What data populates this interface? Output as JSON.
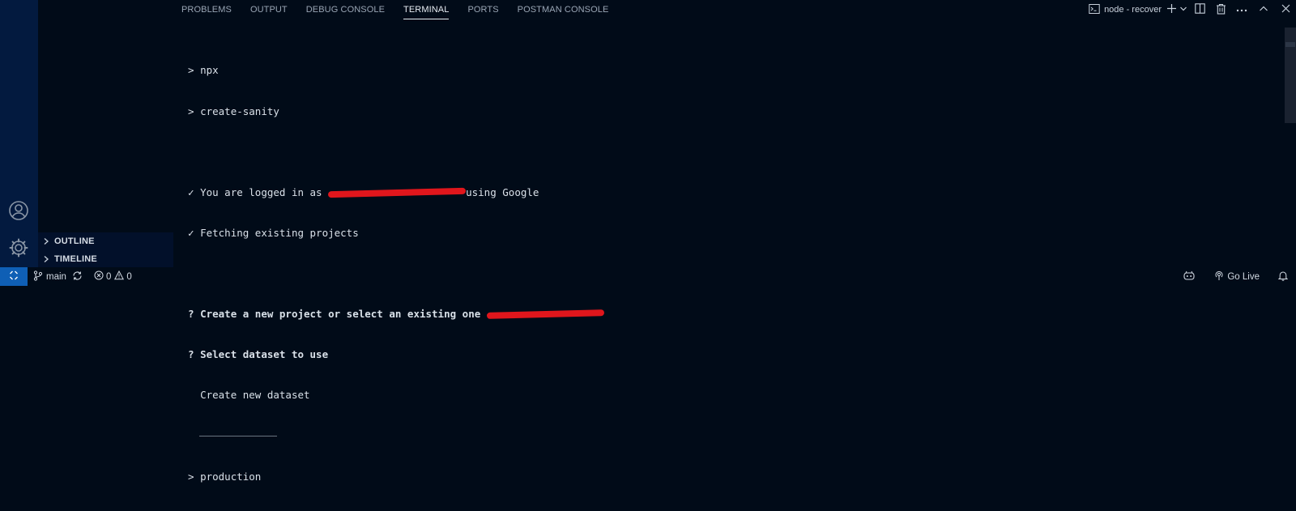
{
  "panel": {
    "tabs": [
      {
        "label": "PROBLEMS"
      },
      {
        "label": "OUTPUT"
      },
      {
        "label": "DEBUG CONSOLE"
      },
      {
        "label": "TERMINAL"
      },
      {
        "label": "PORTS"
      },
      {
        "label": "POSTMAN CONSOLE"
      }
    ],
    "active_tab": "TERMINAL",
    "terminal_name": "node - recover"
  },
  "sidebar": {
    "sections": [
      {
        "label": "OUTLINE"
      },
      {
        "label": "TIMELINE"
      }
    ]
  },
  "terminal": {
    "lines": [
      {
        "prefix": "> ",
        "text": "npx"
      },
      {
        "prefix": "> ",
        "text": "create-sanity"
      },
      {
        "prefix": "",
        "text": ""
      },
      {
        "prefix": "✓ ",
        "text": "You are logged in as",
        "after": "using Google"
      },
      {
        "prefix": "✓ ",
        "text": "Fetching existing projects"
      },
      {
        "prefix": "",
        "text": ""
      },
      {
        "prefix": "? ",
        "text": "Create a new project or select an existing one"
      },
      {
        "prefix": "? ",
        "text": "Select dataset to use"
      },
      {
        "prefix": "  ",
        "text": "Create new dataset"
      },
      {
        "prefix": "> ",
        "text": "production"
      }
    ]
  },
  "statusbar": {
    "branch": "main",
    "errors": "0",
    "warnings": "0",
    "go_live": "Go Live"
  },
  "colors": {
    "background": "#010b18",
    "activity_bar": "#031a3f",
    "remote_button": "#0f5fb5",
    "redaction": "#e0161c"
  }
}
